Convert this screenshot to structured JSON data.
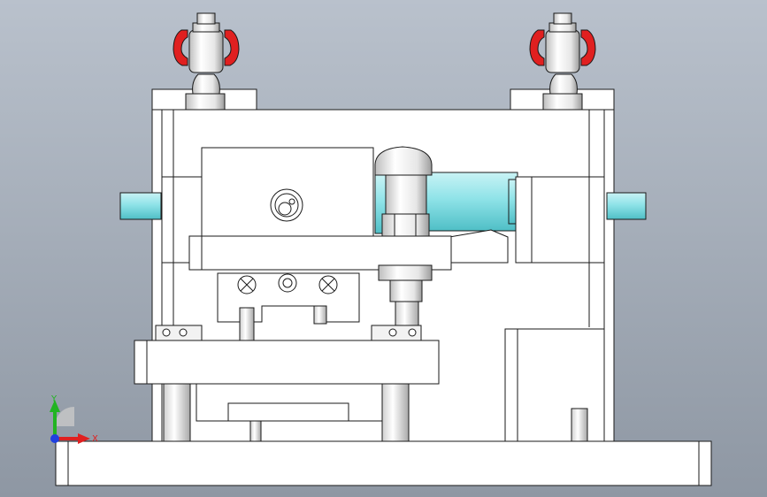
{
  "viewport": {
    "background_top": "#b9c1cc",
    "background_bottom": "#8e97a3"
  },
  "colors": {
    "part_fill": "#ffffff",
    "edge": "#1a1a1a",
    "cylinder_cyan": "#8fe3e8",
    "cylinder_cyan_shade": "#5fc9cf",
    "clamp_red": "#e02020",
    "steel_light": "#e8e8e8",
    "steel_shadow": "#9a9a9a"
  },
  "triad": {
    "x_label": "X",
    "y_label": "Y",
    "x_color": "#e02020",
    "y_color": "#22b422",
    "z_color": "#2040e0"
  }
}
